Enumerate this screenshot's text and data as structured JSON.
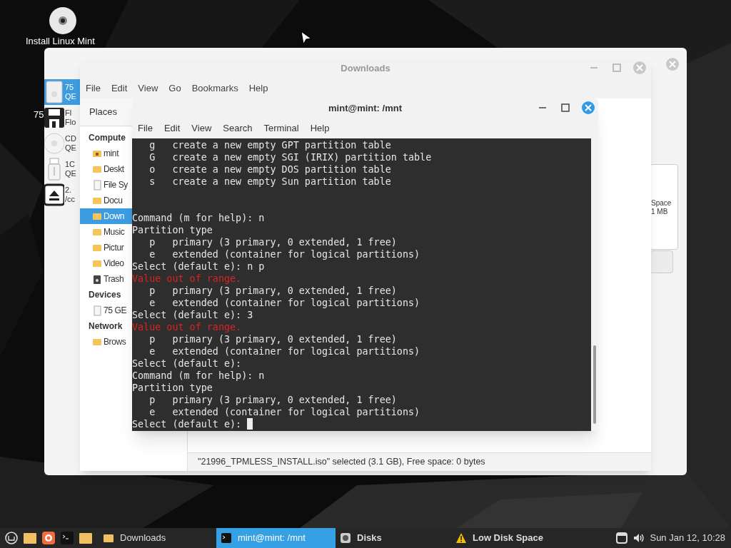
{
  "desktop": {
    "icon_label": "Install Linux Mint",
    "partial_label": "75"
  },
  "disks_window": {
    "devices": [
      {
        "kind": "disk",
        "line1": "75",
        "line2": "QE",
        "selected": true
      },
      {
        "kind": "floppy",
        "line1": "Fl",
        "line2": "Flo",
        "selected": false
      },
      {
        "kind": "cdrom",
        "line1": "CD",
        "line2": "QE",
        "selected": false
      },
      {
        "kind": "usb",
        "line1": "1C",
        "line2": "QE",
        "selected": false
      },
      {
        "kind": "eject",
        "line1": "2.",
        "line2": "/cc",
        "selected": false
      }
    ],
    "volume_info": {
      "line1": "Space",
      "line2": "1 MB"
    }
  },
  "files_window": {
    "title": "Downloads",
    "menu": [
      "File",
      "Edit",
      "View",
      "Go",
      "Bookmarks",
      "Help"
    ],
    "places_header": "Places",
    "sections": [
      {
        "header": "Compute",
        "items": [
          {
            "kind": "home",
            "label": "mint",
            "selected": false
          },
          {
            "kind": "folder",
            "label": "Deskt",
            "selected": false
          },
          {
            "kind": "drive",
            "label": "File Sy",
            "selected": false
          },
          {
            "kind": "folder",
            "label": "Docu",
            "selected": false
          },
          {
            "kind": "folder",
            "label": "Down",
            "selected": true
          },
          {
            "kind": "folder",
            "label": "Music",
            "selected": false
          },
          {
            "kind": "folder",
            "label": "Pictur",
            "selected": false
          },
          {
            "kind": "folder",
            "label": "Video",
            "selected": false
          },
          {
            "kind": "trash",
            "label": "Trash",
            "selected": false
          }
        ]
      },
      {
        "header": "Devices",
        "items": [
          {
            "kind": "drive",
            "label": "75 GE",
            "selected": false
          }
        ]
      },
      {
        "header": "Network",
        "items": [
          {
            "kind": "folder",
            "label": "Brows",
            "selected": false
          }
        ]
      }
    ],
    "status": "\"21996_TPMLESS_INSTALL.iso\" selected (3.1 GB), Free space: 0 bytes"
  },
  "terminal_window": {
    "title": "mint@mint: /mnt",
    "menu": [
      "File",
      "Edit",
      "View",
      "Search",
      "Terminal",
      "Help"
    ],
    "cursor": true,
    "lines": [
      {
        "kind": "normal",
        "text": "   g   create a new empty GPT partition table"
      },
      {
        "kind": "normal",
        "text": "   G   create a new empty SGI (IRIX) partition table"
      },
      {
        "kind": "normal",
        "text": "   o   create a new empty DOS partition table"
      },
      {
        "kind": "normal",
        "text": "   s   create a new empty Sun partition table"
      },
      {
        "kind": "blank"
      },
      {
        "kind": "blank"
      },
      {
        "kind": "normal",
        "text": "Command (m for help): n"
      },
      {
        "kind": "normal",
        "text": "Partition type"
      },
      {
        "kind": "normal",
        "text": "   p   primary (3 primary, 0 extended, 1 free)"
      },
      {
        "kind": "normal",
        "text": "   e   extended (container for logical partitions)"
      },
      {
        "kind": "normal",
        "text": "Select (default e): n p"
      },
      {
        "kind": "error",
        "text": "Value out of range."
      },
      {
        "kind": "normal",
        "text": "   p   primary (3 primary, 0 extended, 1 free)"
      },
      {
        "kind": "normal",
        "text": "   e   extended (container for logical partitions)"
      },
      {
        "kind": "normal",
        "text": "Select (default e): 3"
      },
      {
        "kind": "error",
        "text": "Value out of range."
      },
      {
        "kind": "normal",
        "text": "   p   primary (3 primary, 0 extended, 1 free)"
      },
      {
        "kind": "normal",
        "text": "   e   extended (container for logical partitions)"
      },
      {
        "kind": "normal",
        "text": "Select (default e):"
      },
      {
        "kind": "normal",
        "text": "Command (m for help): n"
      },
      {
        "kind": "normal",
        "text": "Partition type"
      },
      {
        "kind": "normal",
        "text": "   p   primary (3 primary, 0 extended, 1 free)"
      },
      {
        "kind": "normal",
        "text": "   e   extended (container for logical partitions)"
      },
      {
        "kind": "normal",
        "text": "Select (default e): "
      }
    ]
  },
  "taskbar": {
    "launchers": [
      {
        "kind": "mint"
      },
      {
        "kind": "folder"
      },
      {
        "kind": "browser"
      },
      {
        "kind": "terminal"
      },
      {
        "kind": "folder"
      }
    ],
    "tasks": [
      {
        "kind": "folder",
        "label": "Downloads",
        "selected": false
      },
      {
        "kind": "terminal",
        "label": "mint@mint: /mnt",
        "selected": true
      },
      {
        "kind": "disks",
        "label": "Disks",
        "selected": false
      },
      {
        "kind": "warning",
        "label": "Low Disk Space",
        "selected": false
      }
    ],
    "clock": "Sun Jan 12, 10:28"
  }
}
